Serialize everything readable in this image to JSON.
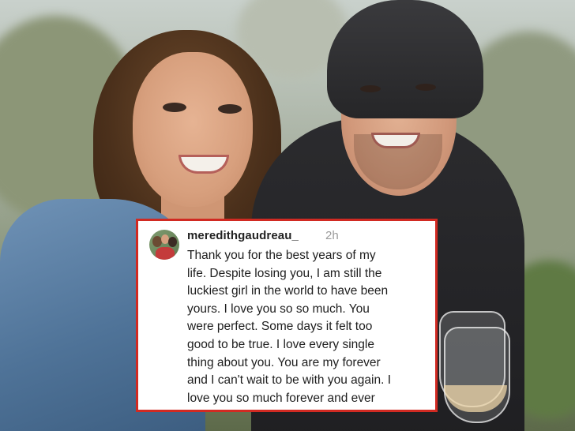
{
  "post": {
    "username": "meredithgaudreau_",
    "timestamp": "2h",
    "lines": [
      "Thank you for the best years of my",
      "life. Despite losing you, I am still the",
      "luckiest girl in the world to have been",
      "yours. I love you so so much. You",
      "were perfect. Some days it felt too",
      "good to be true. I love every single",
      "thing about you. You are my forever",
      "and I can't wait to be with you again. I",
      "love you so much forever and ever"
    ]
  },
  "colors": {
    "card_border": "#d12a22",
    "card_background": "#ffffff"
  }
}
